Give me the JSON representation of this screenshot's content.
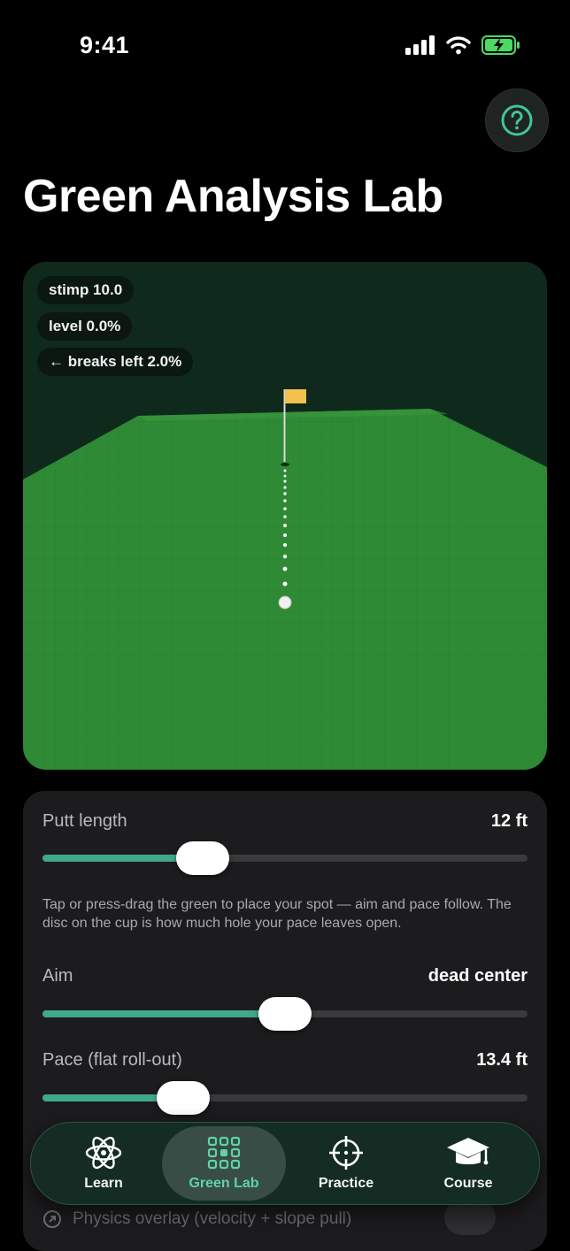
{
  "status_bar": {
    "time": "9:41"
  },
  "header": {
    "title": "Green Analysis Lab",
    "help_icon": "question-circle-icon"
  },
  "viewer": {
    "chips": [
      "stimp 10.0",
      "level 0.0%",
      "← breaks left 2.0%"
    ],
    "flag_color": "#f2c14e",
    "green_color": "#2f8a35"
  },
  "controls": {
    "putt_length": {
      "label": "Putt length",
      "value": "12 ft",
      "fraction": 0.33
    },
    "hint": "Tap or press-drag the green to place your spot — aim and pace follow. The disc on the cup is how much hole your pace leaves open.",
    "aim": {
      "label": "Aim",
      "value": "dead center",
      "fraction": 0.5
    },
    "pace": {
      "label": "Pace (flat roll-out)",
      "value": "13.4 ft",
      "fraction": 0.29
    },
    "physics_overlay": {
      "label": "Physics overlay (velocity + slope pull)"
    }
  },
  "tabbar": {
    "tabs": [
      {
        "label": "Learn",
        "icon": "atom-icon",
        "active": false
      },
      {
        "label": "Green Lab",
        "icon": "grid-icon",
        "active": true
      },
      {
        "label": "Practice",
        "icon": "crosshair-icon",
        "active": false
      },
      {
        "label": "Course",
        "icon": "graduation-cap-icon",
        "active": false
      }
    ]
  },
  "colors": {
    "accent": "#41a98a",
    "active_tab_text": "#5fd3a6",
    "panel": "#1c1c1e"
  }
}
